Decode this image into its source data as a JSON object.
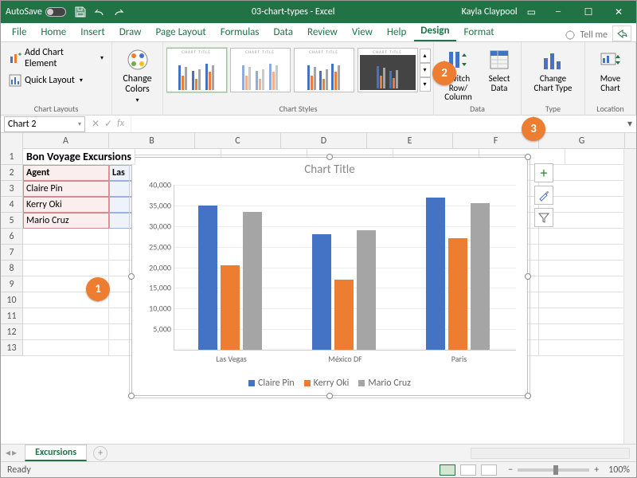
{
  "titlebar": {
    "autosave": "AutoSave",
    "filename": "03-chart-types - Excel",
    "username": "Kayla Claypool"
  },
  "tabs": {
    "file": "File",
    "home": "Home",
    "insert": "Insert",
    "draw": "Draw",
    "pagelayout": "Page Layout",
    "formulas": "Formulas",
    "data": "Data",
    "review": "Review",
    "view": "View",
    "help": "Help",
    "design": "Design",
    "format": "Format",
    "tellme": "Tell me"
  },
  "ribbon": {
    "layouts": {
      "add_element": "Add Chart Element",
      "quick_layout": "Quick Layout",
      "group": "Chart Layouts"
    },
    "colors": {
      "label": "Change Colors",
      "group": ""
    },
    "styles": {
      "group": "Chart Styles",
      "chip_title": "CHART TITLE"
    },
    "data_group": {
      "switch": "Switch Row/ Column",
      "select": "Select Data",
      "group": "Data"
    },
    "type_group": {
      "change": "Change Chart Type",
      "group": "Type"
    },
    "loc_group": {
      "move": "Move Chart",
      "group": "Location"
    }
  },
  "namebox": "Chart 2",
  "fx_label": "fx",
  "columns": [
    "A",
    "B",
    "C",
    "D",
    "E",
    "F",
    "G"
  ],
  "cells": {
    "r1": {
      "A": "Bon Voyage Excursions"
    },
    "r2": {
      "A": "Agent",
      "B": "Las"
    },
    "r3": {
      "A": "Claire Pin"
    },
    "r4": {
      "A": "Kerry Oki"
    },
    "r5": {
      "A": "Mario Cruz"
    }
  },
  "chart_data": {
    "type": "bar",
    "title": "Chart Title",
    "categories": [
      "Las Vegas",
      "México DF",
      "Paris"
    ],
    "series": [
      {
        "name": "Claire Pin",
        "values": [
          35000,
          28000,
          37000
        ],
        "color": "#4472C4"
      },
      {
        "name": "Kerry Oki",
        "values": [
          20500,
          17000,
          27000
        ],
        "color": "#ED7D31"
      },
      {
        "name": "Mario Cruz",
        "values": [
          33500,
          29000,
          35500
        ],
        "color": "#A5A5A5"
      }
    ],
    "ylim": [
      0,
      40000
    ],
    "yticks": [
      5000,
      10000,
      15000,
      20000,
      25000,
      30000,
      35000,
      40000
    ],
    "ytick_labels": [
      "5,000",
      "10,000",
      "15,000",
      "20,000",
      "25,000",
      "30,000",
      "35,000",
      "40,000"
    ]
  },
  "sheettab": "Excursions",
  "status": "Ready",
  "zoom": "100%"
}
